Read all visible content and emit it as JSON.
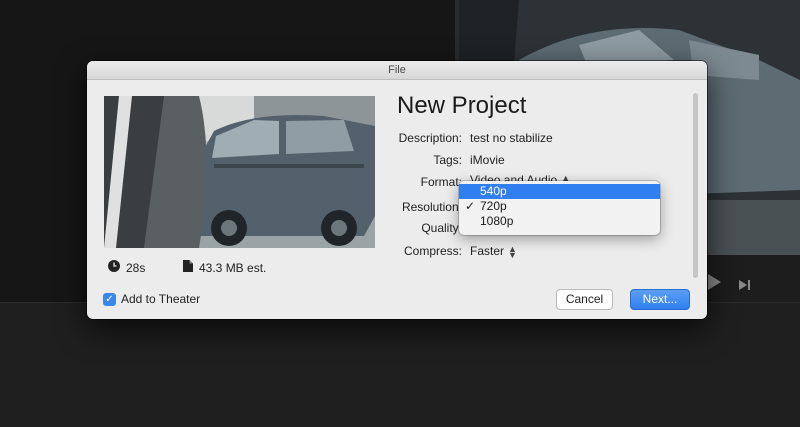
{
  "dialog": {
    "window_title": "File",
    "project_title": "New Project",
    "fields": {
      "description": {
        "label": "Description:",
        "value": "test no stabilize"
      },
      "tags": {
        "label": "Tags:",
        "value": "iMovie"
      },
      "format": {
        "label": "Format:",
        "value": "Video and Audio"
      },
      "resolution": {
        "label": "Resolution:"
      },
      "quality": {
        "label": "Quality:"
      },
      "compress": {
        "label": "Compress:",
        "value": "Faster"
      }
    },
    "duration": "28s",
    "file_size": "43.3 MB est.",
    "add_to_theater": {
      "label": "Add to Theater",
      "checked": true
    },
    "cancel_label": "Cancel",
    "next_label": "Next..."
  },
  "resolution_menu": {
    "items": [
      {
        "label": "540p",
        "highlighted": true,
        "checked": false
      },
      {
        "label": "720p",
        "highlighted": false,
        "checked": true
      },
      {
        "label": "1080p",
        "highlighted": false,
        "checked": false
      }
    ]
  },
  "colors": {
    "accent": "#2f7ff1",
    "dialog_bg": "#ececec",
    "app_bg": "#1b1b1b"
  },
  "icons": [
    "clock-icon",
    "file-icon",
    "checkmark-icon",
    "play-icon",
    "next-frame-icon",
    "stepper-icon"
  ]
}
